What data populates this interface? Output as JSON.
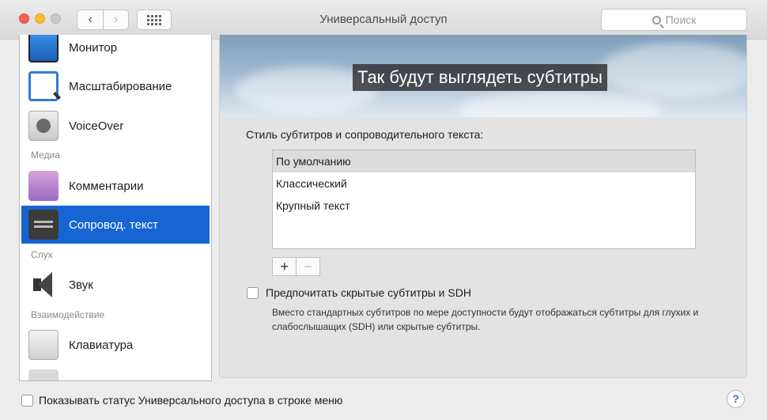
{
  "window": {
    "title": "Универсальный доступ",
    "search_placeholder": "Поиск",
    "nav_back": "‹",
    "nav_forward": "›"
  },
  "sidebar": {
    "items": [
      {
        "label": "Монитор",
        "icon": "monitor-icon"
      },
      {
        "label": "Масштабирование",
        "icon": "zoom-icon"
      },
      {
        "label": "VoiceOver",
        "icon": "voiceover-icon"
      },
      {
        "label": "Комментарии",
        "icon": "comments-icon"
      },
      {
        "label": "Сопровод. текст",
        "icon": "captions-icon",
        "selected": true
      },
      {
        "label": "Звук",
        "icon": "speaker-icon"
      },
      {
        "label": "Клавиатура",
        "icon": "keyboard-icon"
      }
    ],
    "headers": {
      "media": "Медиа",
      "hearing": "Слух",
      "interaction": "Взаимодействие"
    }
  },
  "content": {
    "preview_text": "Так будут выглядеть субтитры",
    "style_label": "Стиль субтитров и сопроводительного текста:",
    "styles": [
      {
        "label": "По умолчанию",
        "selected": true
      },
      {
        "label": "Классический"
      },
      {
        "label": "Крупный текст"
      }
    ],
    "add_label": "+",
    "remove_label": "−",
    "sdh_checkbox": {
      "label": "Предпочитать скрытые субтитры и SDH",
      "checked": false,
      "description": "Вместо стандартных субтитров по мере доступности будут отображаться субтитры для глухих и слабослышащих (SDH) или скрытые субтитры."
    }
  },
  "footer": {
    "status_checkbox_label": "Показывать статус Универсального доступа в строке меню",
    "status_checked": false,
    "help_label": "?"
  },
  "colors": {
    "selection": "#1665d3",
    "list_selection": "#dcdcdc"
  }
}
